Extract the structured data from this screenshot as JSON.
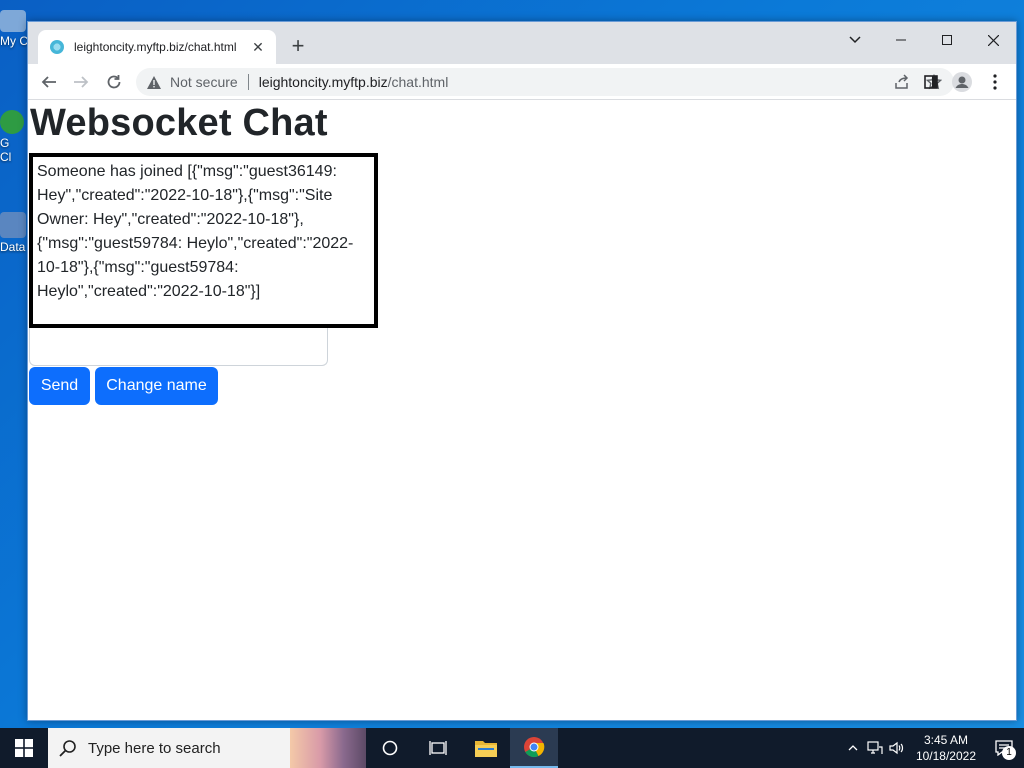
{
  "desktop": {
    "icons": [
      {
        "label": "My C",
        "color": "#7ea8d8"
      },
      {
        "label": "G\nCl",
        "color": "#2e9b43"
      },
      {
        "label": "Data",
        "color": "#5a86c0"
      }
    ]
  },
  "browser": {
    "tab": {
      "title": "leightoncity.myftp.biz/chat.html",
      "close": "✕"
    },
    "new_tab": "+",
    "address": {
      "security_label": "Not secure",
      "url_host": "leightoncity.myftp.biz",
      "url_path": "/chat.html"
    }
  },
  "page": {
    "title": "Websocket Chat",
    "chat_log": "Someone has joined\n[{\"msg\":\"guest36149: Hey\",\"created\":\"2022-10-18\"},{\"msg\":\"Site Owner: Hey\",\"created\":\"2022-10-18\"},{\"msg\":\"guest59784: Heylo\",\"created\":\"2022-10-18\"},{\"msg\":\"guest59784: Heylo\",\"created\":\"2022-10-18\"}]",
    "message_input": {
      "value": "",
      "placeholder": ""
    },
    "send_label": "Send",
    "change_name_label": "Change name",
    "button_color": "#0d6efd"
  },
  "taskbar": {
    "search_placeholder": "Type here to search",
    "clock_time": "3:45 AM",
    "clock_date": "10/18/2022",
    "notification_count": "1"
  }
}
